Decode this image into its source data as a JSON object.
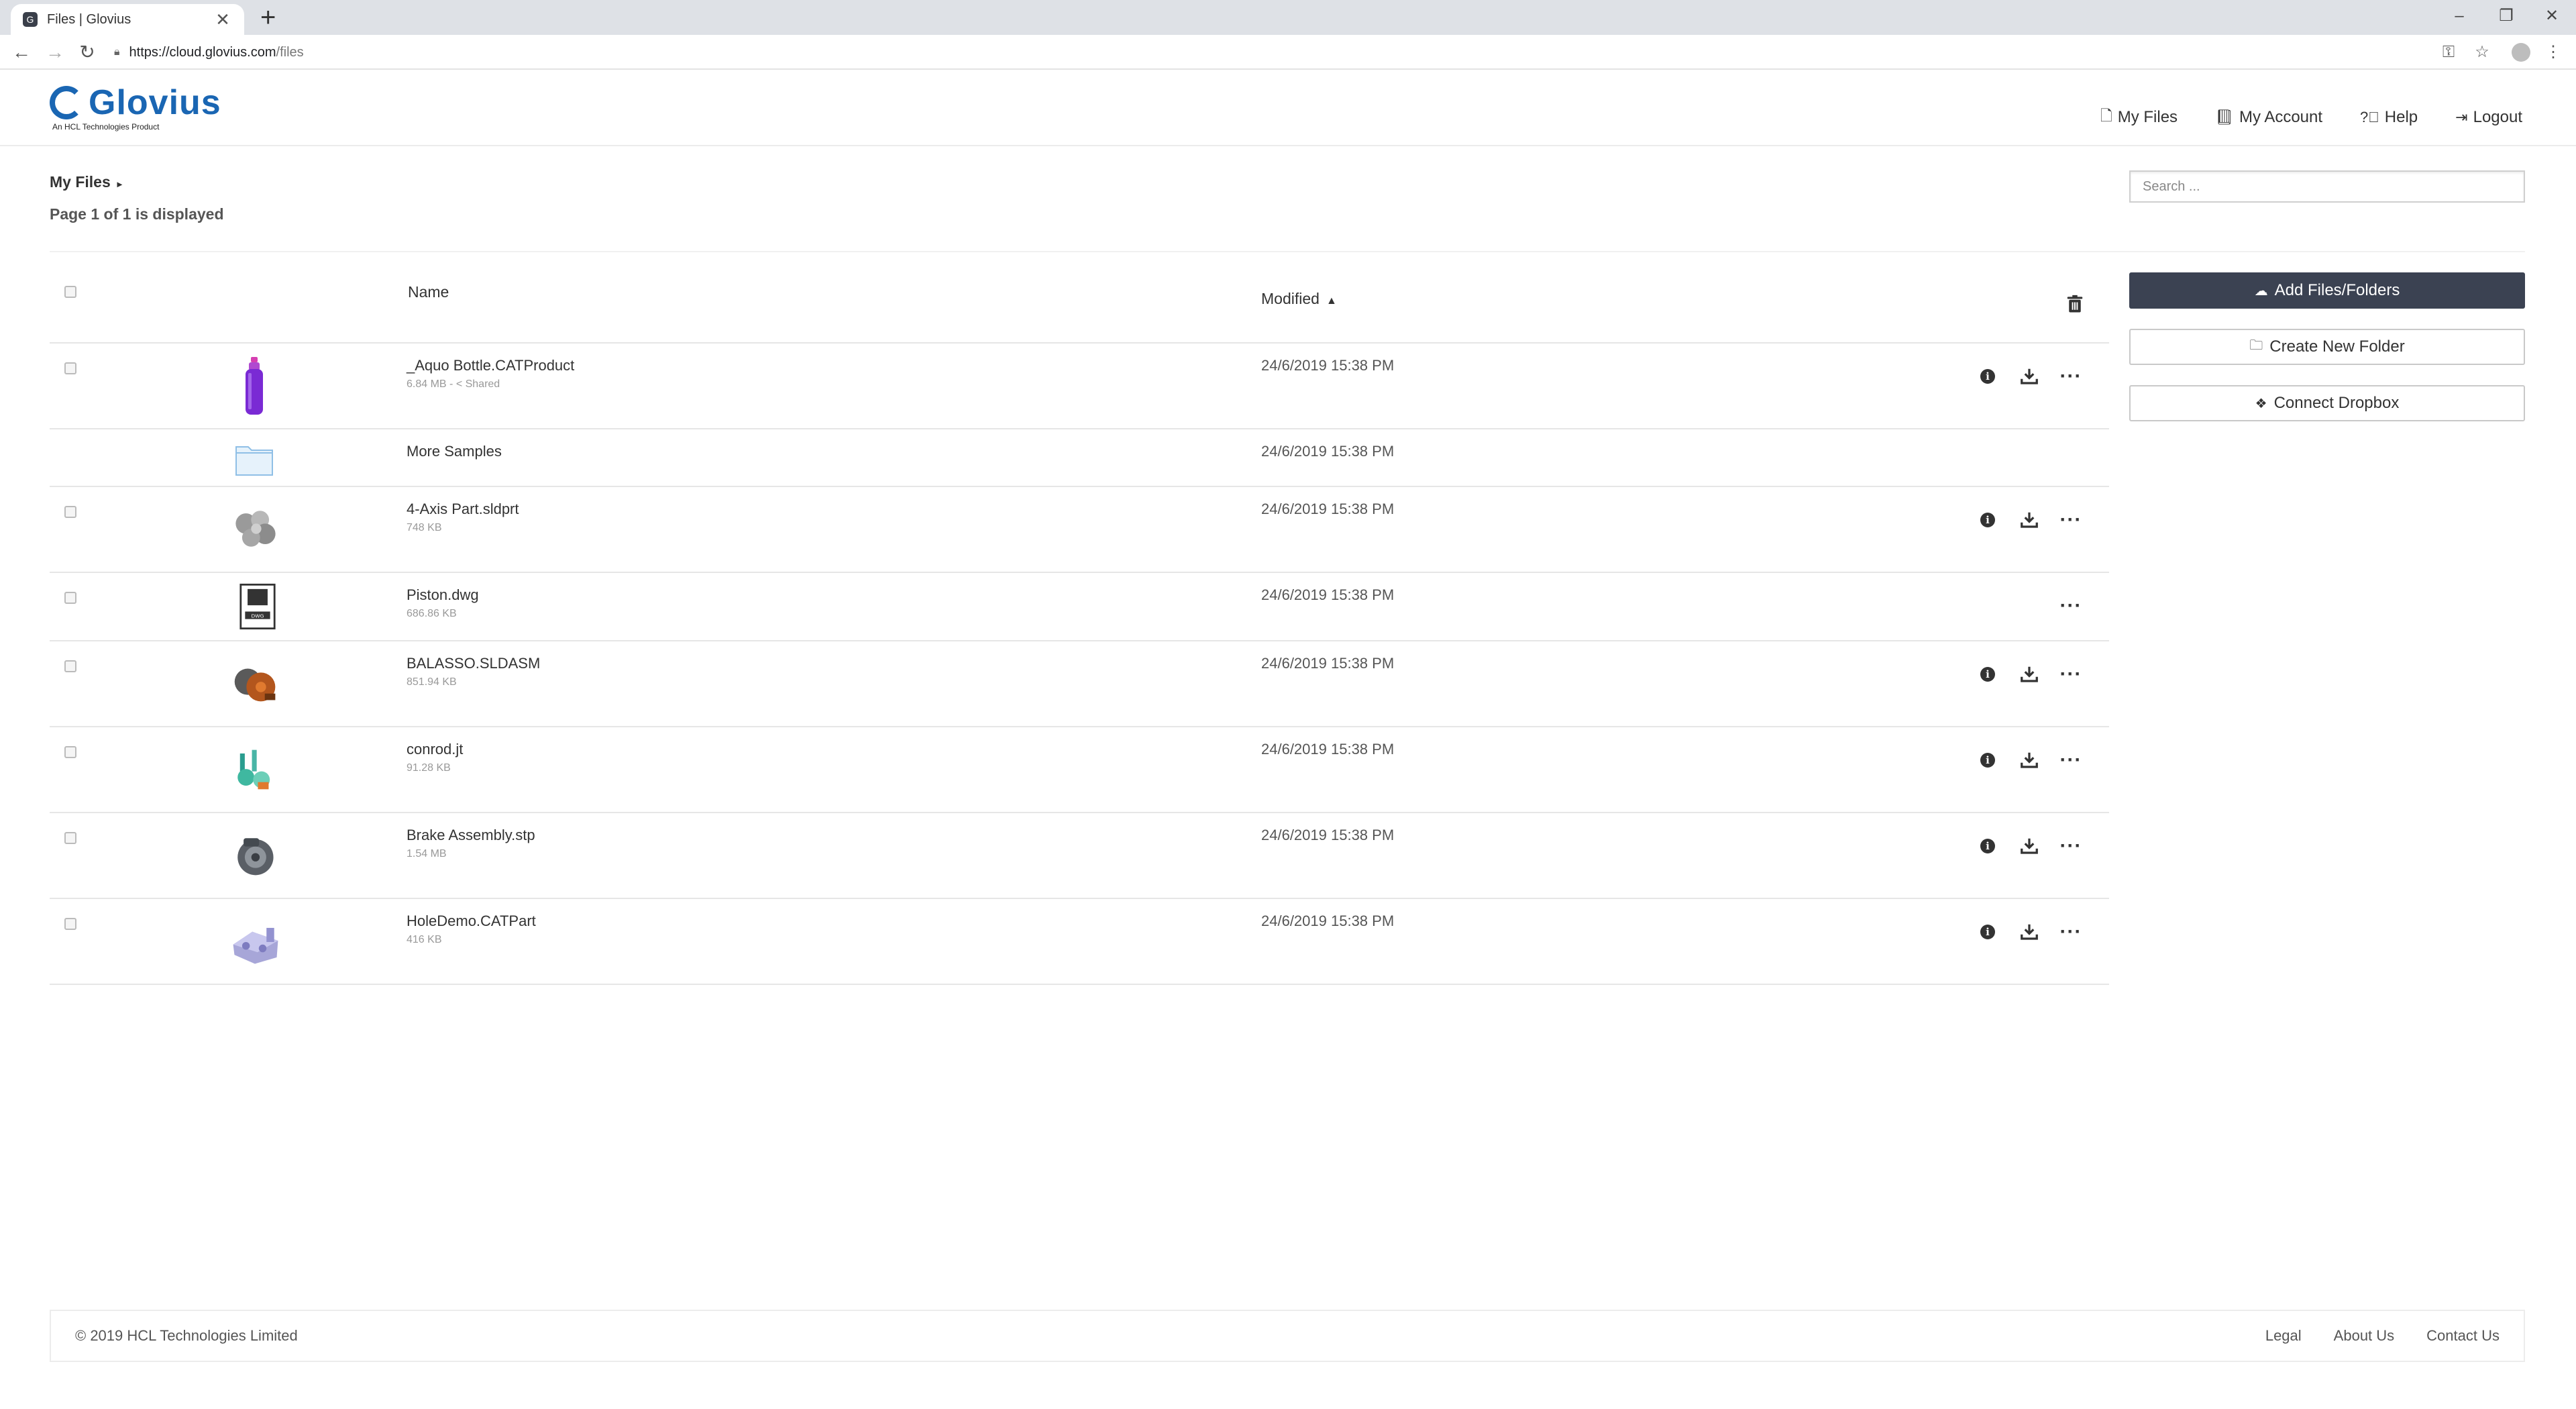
{
  "browser": {
    "tab_title": "Files | Glovius",
    "tab_close": "✕",
    "new_tab": "+",
    "minimize": "–",
    "restore": "❐",
    "close": "✕",
    "url_host": "https://cloud.glovius.com",
    "url_path": "/files"
  },
  "header": {
    "logo_text": "Glovius",
    "logo_subtitle": "An HCL Technologies Product",
    "nav": [
      {
        "label": "My Files",
        "icon": "files-icon"
      },
      {
        "label": "My Account",
        "icon": "book-icon"
      },
      {
        "label": "Help",
        "icon": "help-icon"
      },
      {
        "label": "Logout",
        "icon": "logout-icon"
      }
    ]
  },
  "breadcrumb": {
    "label": "My Files",
    "caret": "▸"
  },
  "page_status": "Page 1 of 1 is displayed",
  "search": {
    "placeholder": "Search ..."
  },
  "table": {
    "col_name": "Name",
    "col_modified": "Modified",
    "sort_indicator": "▲",
    "rows": [
      {
        "name": "_Aquo Bottle.CATProduct",
        "size": "6.84 MB",
        "shared": "Shared",
        "modified": "24/6/2019 15:38 PM",
        "thumb": "bottle-thumbnail"
      },
      {
        "name": "More Samples",
        "modified": "24/6/2019 15:38 PM",
        "thumb": "folder-icon"
      },
      {
        "name": "4-Axis Part.sldprt",
        "size": "748 KB",
        "modified": "24/6/2019 15:38 PM",
        "thumb": "part-thumbnail"
      },
      {
        "name": "Piston.dwg",
        "size": "686.86 KB",
        "modified": "24/6/2019 15:38 PM",
        "thumb": "dwg-file-icon"
      },
      {
        "name": "BALASSO.SLDASM",
        "size": "851.94 KB",
        "modified": "24/6/2019 15:38 PM",
        "thumb": "assembly-thumbnail"
      },
      {
        "name": "conrod.jt",
        "size": "91.28 KB",
        "modified": "24/6/2019 15:38 PM",
        "thumb": "conrod-thumbnail"
      },
      {
        "name": "Brake Assembly.stp",
        "size": "1.54 MB",
        "modified": "24/6/2019 15:38 PM",
        "thumb": "brake-thumbnail"
      },
      {
        "name": "HoleDemo.CATPart",
        "size": "416 KB",
        "modified": "24/6/2019 15:38 PM",
        "thumb": "holedemo-thumbnail"
      }
    ]
  },
  "actions": {
    "add_files": "Add Files/Folders",
    "create_folder": "Create New Folder",
    "connect_dropbox": "Connect Dropbox"
  },
  "footer": {
    "copyright": "© 2019 HCL Technologies Limited",
    "links": [
      "Legal",
      "About Us",
      "Contact Us"
    ]
  },
  "colors": {
    "brand": "#1a66b3",
    "primary_button": "#3b4252",
    "folder": "#a9cdea"
  }
}
